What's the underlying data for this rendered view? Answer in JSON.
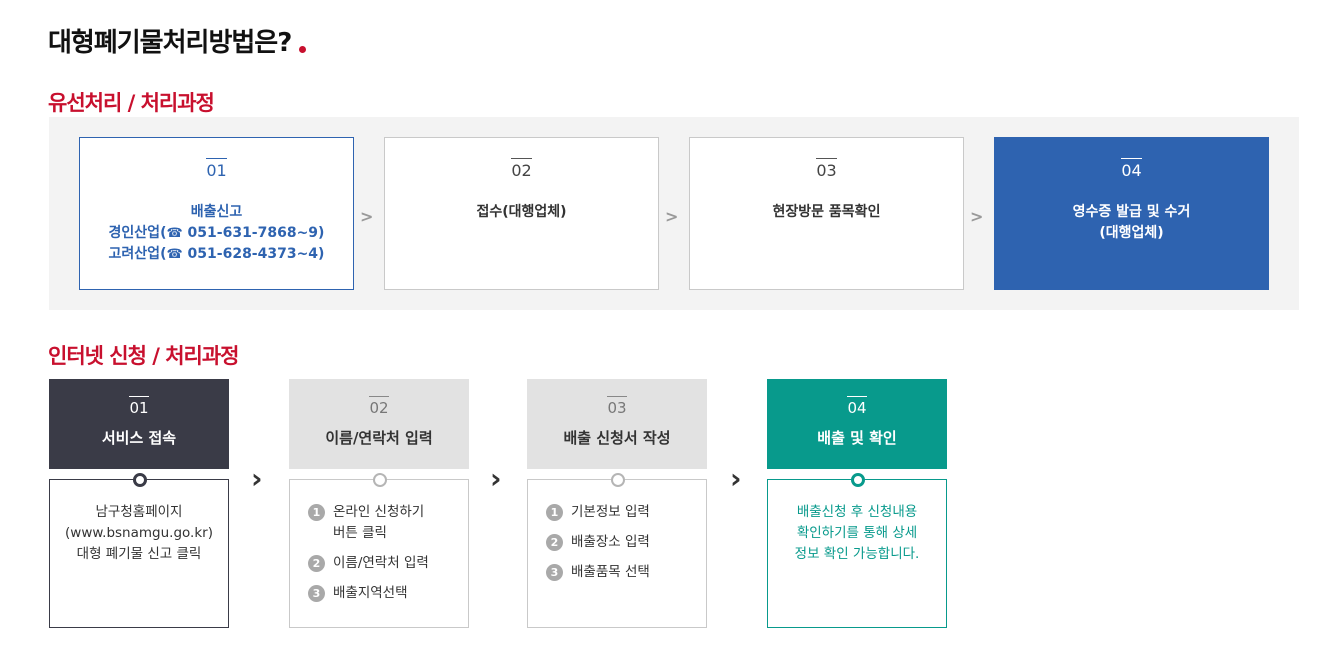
{
  "page": {
    "title": "대형폐기물처리방법은?"
  },
  "wired": {
    "title": "유선처리 / 처리과정",
    "separator": ">",
    "steps": [
      {
        "num": "01",
        "label": "배출신고",
        "line2": "경인산업(",
        "phone1": "051-631-7868~9)",
        "line3": "고려산업(",
        "phone2": "051-628-4373~4)"
      },
      {
        "num": "02",
        "label": "접수(대행업체)"
      },
      {
        "num": "03",
        "label": "현장방문 품목확인"
      },
      {
        "num": "04",
        "label": "영수증 발급 및 수거",
        "label2": "(대행업체)"
      }
    ]
  },
  "internet": {
    "title": "인터넷 신청 / 처리과정",
    "chevron": "›",
    "steps": [
      {
        "num": "01",
        "label": "서비스 접속",
        "lines": [
          "남구청홈페이지",
          "(www.bsnamgu.go.kr)",
          "대형 폐기물 신고 클릭"
        ]
      },
      {
        "num": "02",
        "label": "이름/연락처 입력",
        "items": [
          {
            "n": "1",
            "text": "온라인 신청하기",
            "text2": "버튼 클릭"
          },
          {
            "n": "2",
            "text": "이름/연락처 입력"
          },
          {
            "n": "3",
            "text": "배출지역선택"
          }
        ]
      },
      {
        "num": "03",
        "label": "배출 신청서 작성",
        "items": [
          {
            "n": "1",
            "text": "기본정보 입력"
          },
          {
            "n": "2",
            "text": "배출장소 입력"
          },
          {
            "n": "3",
            "text": "배출품목 선택"
          }
        ]
      },
      {
        "num": "04",
        "label": "배출 및 확인",
        "lines": [
          "배출신청 후 신청내용",
          "확인하기를 통해 상세",
          "정보 확인 가능합니다."
        ]
      }
    ]
  },
  "colors": {
    "accent_red": "#c8102e",
    "blue": "#2e63b0",
    "dark": "#3a3b47",
    "teal": "#089a8c"
  },
  "icons": {
    "phone": "☎"
  }
}
